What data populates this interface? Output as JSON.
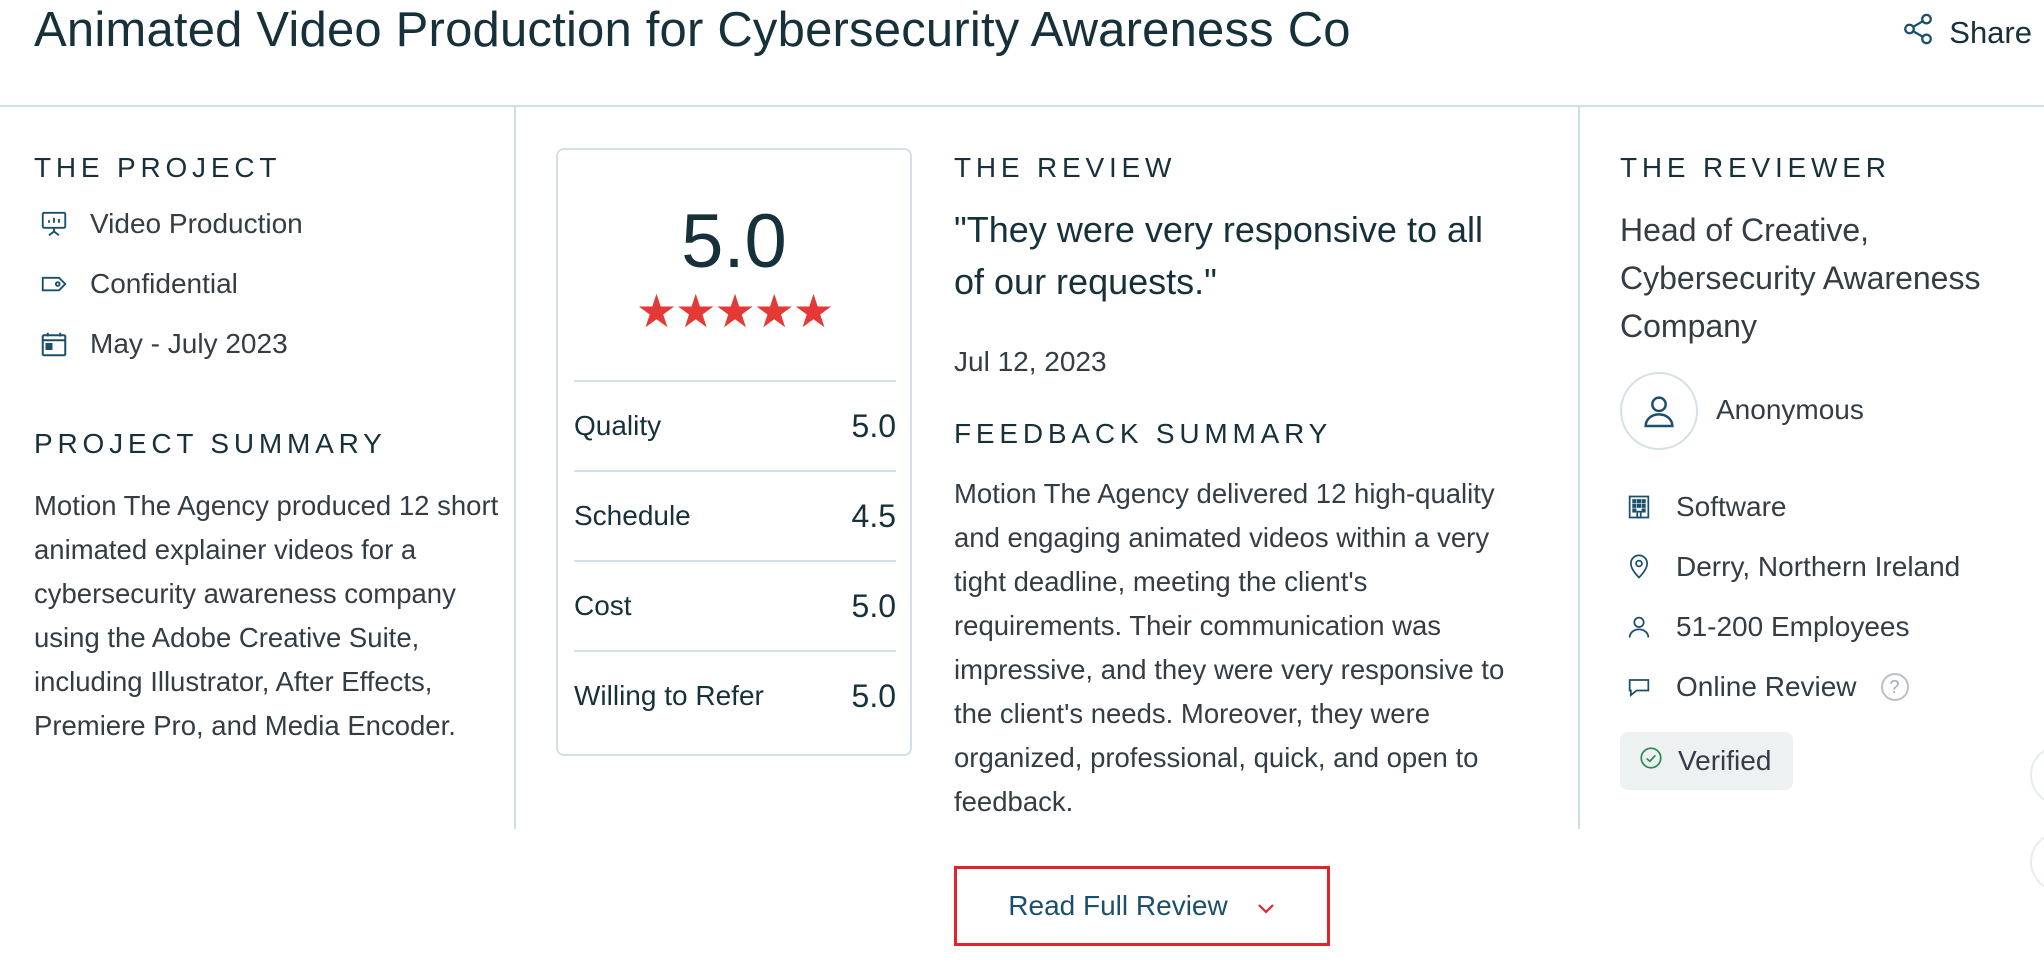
{
  "header": {
    "title": "Animated Video Production for Cybersecurity Awareness Co",
    "share_label": "Share"
  },
  "project": {
    "heading": "THE PROJECT",
    "service": "Video Production",
    "budget": "Confidential",
    "dates": "May - July 2023",
    "summary_heading": "PROJECT SUMMARY",
    "summary": "Motion The Agency produced 12 short animated explainer videos for a cybersecurity awareness company using the Adobe Creative Suite, including Illustrator, After Effects, Premiere Pro, and Media Encoder."
  },
  "scores": {
    "overall": "5.0",
    "stars": "★★★★★",
    "rating_value": 5,
    "rows": [
      {
        "label": "Quality",
        "value": "5.0"
      },
      {
        "label": "Schedule",
        "value": "4.5"
      },
      {
        "label": "Cost",
        "value": "5.0"
      },
      {
        "label": "Willing to Refer",
        "value": "5.0"
      }
    ]
  },
  "review": {
    "heading": "THE REVIEW",
    "quote": "\"They were very responsive to all of our requests.\"",
    "date": "Jul 12, 2023",
    "feedback_heading": "FEEDBACK SUMMARY",
    "feedback": "Motion The Agency delivered 12 high-quality and engaging animated videos within a very tight deadline, meeting the client's requirements. Their communication was impressive, and they were very responsive to the client's needs. Moreover, they were organized, professional, quick, and open to feedback.",
    "read_full_label": "Read Full Review"
  },
  "reviewer": {
    "heading": "THE REVIEWER",
    "title": "Head of Creative, Cybersecurity Awareness Company",
    "name": "Anonymous",
    "industry": "Software",
    "location": "Derry, Northern Ireland",
    "size": "51-200 Employees",
    "review_type": "Online Review",
    "help_glyph": "?",
    "verified_label": "Verified"
  },
  "colors": {
    "accent_red": "#e53935",
    "text_dark": "#17313b",
    "divider": "#cfdde4",
    "button_border": "#e0242d",
    "verified_green": "#2e8b57"
  },
  "icons": {
    "share": "share-icon",
    "service": "presentation-icon",
    "budget": "tag-icon",
    "dates": "calendar-icon",
    "industry": "building-icon",
    "location": "location-pin-icon",
    "size": "user-icon",
    "review_type": "chat-bubble-icon",
    "verified": "check-circle-icon",
    "read_more": "chevron-down-icon"
  }
}
